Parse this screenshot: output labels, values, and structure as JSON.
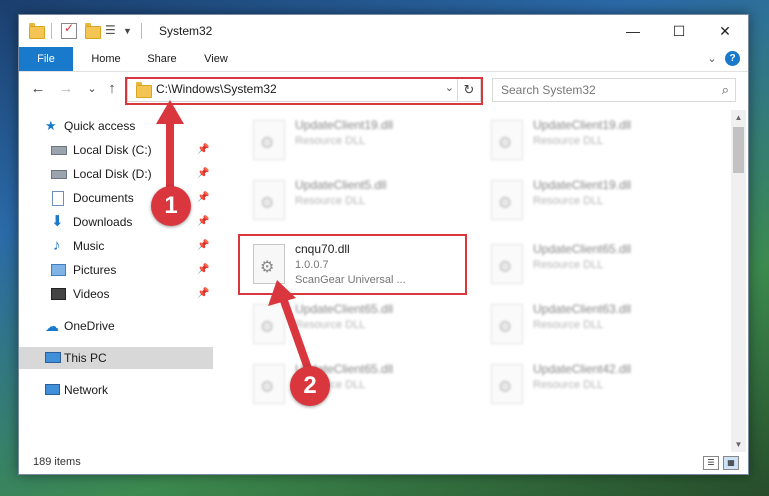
{
  "window": {
    "title": "System32",
    "controls": {
      "minimize": "—",
      "maximize": "☐",
      "close": "✕"
    }
  },
  "ribbon": {
    "tabs": [
      {
        "label": "File"
      },
      {
        "label": "Home"
      },
      {
        "label": "Share"
      },
      {
        "label": "View"
      }
    ],
    "expand_glyph": "⌄",
    "help_glyph": "?"
  },
  "address": {
    "path": "C:\\Windows\\System32",
    "dropdown_glyph": "⌄",
    "refresh_glyph": "↻"
  },
  "search": {
    "placeholder": "Search System32",
    "icon_glyph": "⌕"
  },
  "nav": {
    "back_glyph": "←",
    "forward_glyph": "→",
    "recent_glyph": "⌄",
    "up_glyph": "↑"
  },
  "sidebar": {
    "items": [
      {
        "label": "Quick access",
        "icon": "star-icon",
        "pinned": false
      },
      {
        "label": "Local Disk (C:)",
        "icon": "drive-icon",
        "pinned": true
      },
      {
        "label": "Local Disk (D:)",
        "icon": "drive-icon",
        "pinned": true
      },
      {
        "label": "Documents",
        "icon": "documents-icon",
        "pinned": true
      },
      {
        "label": "Downloads",
        "icon": "download-icon",
        "pinned": true
      },
      {
        "label": "Music",
        "icon": "music-icon",
        "pinned": true
      },
      {
        "label": "Pictures",
        "icon": "pictures-icon",
        "pinned": true
      },
      {
        "label": "Videos",
        "icon": "videos-icon",
        "pinned": true
      },
      {
        "label": "OneDrive",
        "icon": "cloud-icon",
        "pinned": false
      },
      {
        "label": "This PC",
        "icon": "computer-icon",
        "pinned": false,
        "selected": true
      },
      {
        "label": "Network",
        "icon": "network-icon",
        "pinned": false
      }
    ],
    "pin_glyph": "📌"
  },
  "files": [
    {
      "name": "UpdateClient19.dll",
      "type": "Resource DLL"
    },
    {
      "name": "UpdateClient19.dll",
      "type": "Resource DLL"
    },
    {
      "name": "UpdateClient5.dll",
      "type": "Resource DLL"
    },
    {
      "name": "UpdateClient19.dll",
      "type": "Resource DLL"
    },
    {
      "name": "cnqu70.dll",
      "version": "1.0.0.7",
      "type": "ScanGear Universal ..."
    },
    {
      "name": "UpdateClient65.dll",
      "type": "Resource DLL"
    },
    {
      "name": "UpdateClient65.dll",
      "type": "Resource DLL"
    },
    {
      "name": "UpdateClient63.dll",
      "type": "Resource DLL"
    },
    {
      "name": "UpdateClient65.dll",
      "type": "Resource DLL"
    },
    {
      "name": "UpdateClient42.dll",
      "type": "Resource DLL"
    }
  ],
  "status": {
    "item_count": "189 items"
  },
  "annotations": {
    "callout_1": "1",
    "callout_2": "2"
  },
  "colors": {
    "accent": "#1979ca",
    "annotation": "#d9363e"
  }
}
